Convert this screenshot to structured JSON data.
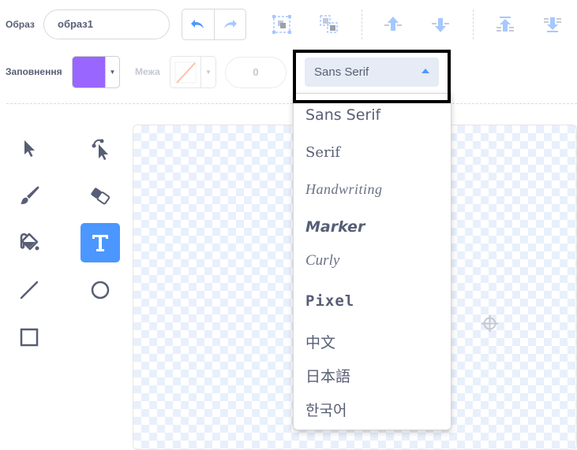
{
  "toolbar": {
    "costume_label": "Образ",
    "costume_name": "образ1",
    "fill_label": "Заповнення",
    "outline_label": "Межа",
    "outline_width": "0",
    "font_selected": "Sans Serif"
  },
  "colors": {
    "fill": "#9966ff",
    "accent": "#4c97ff",
    "text": "#575e75"
  },
  "tools": [
    {
      "name": "select-tool",
      "icon": "arrow-cursor-icon"
    },
    {
      "name": "reshape-tool",
      "icon": "reshape-cursor-icon"
    },
    {
      "name": "brush-tool",
      "icon": "brush-icon"
    },
    {
      "name": "eraser-tool",
      "icon": "eraser-icon"
    },
    {
      "name": "fill-tool",
      "icon": "paint-bucket-icon"
    },
    {
      "name": "text-tool",
      "icon": "text-t-icon",
      "active": true
    },
    {
      "name": "line-tool",
      "icon": "line-icon"
    },
    {
      "name": "circle-tool",
      "icon": "circle-icon"
    },
    {
      "name": "rectangle-tool",
      "icon": "square-icon"
    }
  ],
  "font_options": [
    "Sans Serif",
    "Serif",
    "Handwriting",
    "Marker",
    "Curly",
    "Pixel",
    "中文",
    "日本語",
    "한국어"
  ]
}
